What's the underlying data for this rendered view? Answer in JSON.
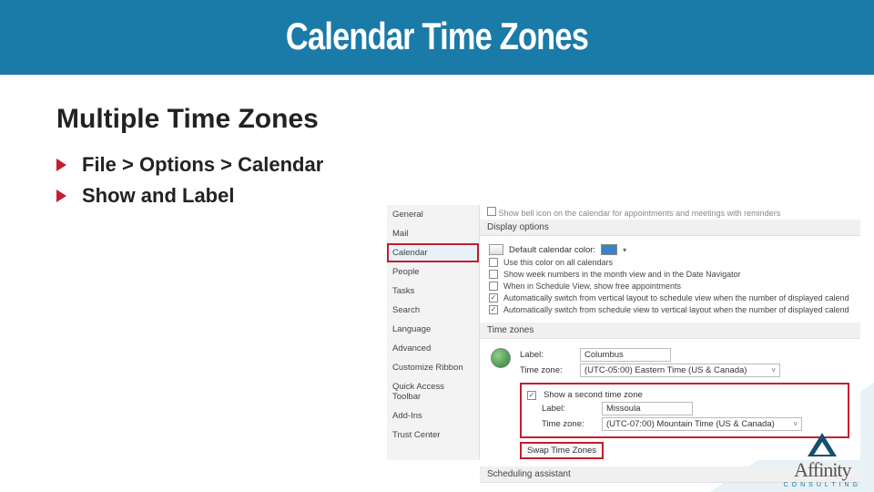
{
  "header": {
    "title": "Calendar Time Zones"
  },
  "section": {
    "title": "Multiple Time Zones"
  },
  "bullets": [
    {
      "text": "File > Options > Calendar"
    },
    {
      "text": "Show and Label"
    }
  ],
  "sidebar": {
    "items": [
      {
        "label": "General"
      },
      {
        "label": "Mail"
      },
      {
        "label": "Calendar",
        "selected": true
      },
      {
        "label": "People"
      },
      {
        "label": "Tasks"
      },
      {
        "label": "Search"
      },
      {
        "label": "Language"
      },
      {
        "label": "Advanced"
      },
      {
        "label": "Customize Ribbon"
      },
      {
        "label": "Quick Access Toolbar"
      },
      {
        "label": "Add-Ins"
      },
      {
        "label": "Trust Center"
      }
    ]
  },
  "display_options": {
    "top_text": "Show bell icon on the calendar for appointments and meetings with reminders",
    "section_title": "Display options",
    "default_color_label": "Default calendar color:",
    "use_all": "Use this color on all calendars",
    "show_week_num": "Show week numbers in the month view and in the Date Navigator",
    "schedule_free": "When in Schedule View, show free appointments",
    "auto_v2s": "Automatically switch from vertical layout to schedule view when the number of displayed calendars is",
    "auto_s2v": "Automatically switch from schedule view to vertical layout when the number of displayed calendars is"
  },
  "time_zones": {
    "section_title": "Time zones",
    "label_label": "Label:",
    "tz_label": "Time zone:",
    "primary": {
      "label_value": "Columbus",
      "tz_value": "(UTC-05:00) Eastern Time (US & Canada)"
    },
    "show_second_label": "Show a second time zone",
    "second": {
      "label_value": "Missoula",
      "tz_value": "(UTC-07:00) Mountain Time (US & Canada)"
    },
    "swap_label": "Swap Time Zones",
    "scheduling": "Scheduling assistant"
  },
  "logo": {
    "name": "Affinity",
    "tag": "CONSULTING"
  }
}
